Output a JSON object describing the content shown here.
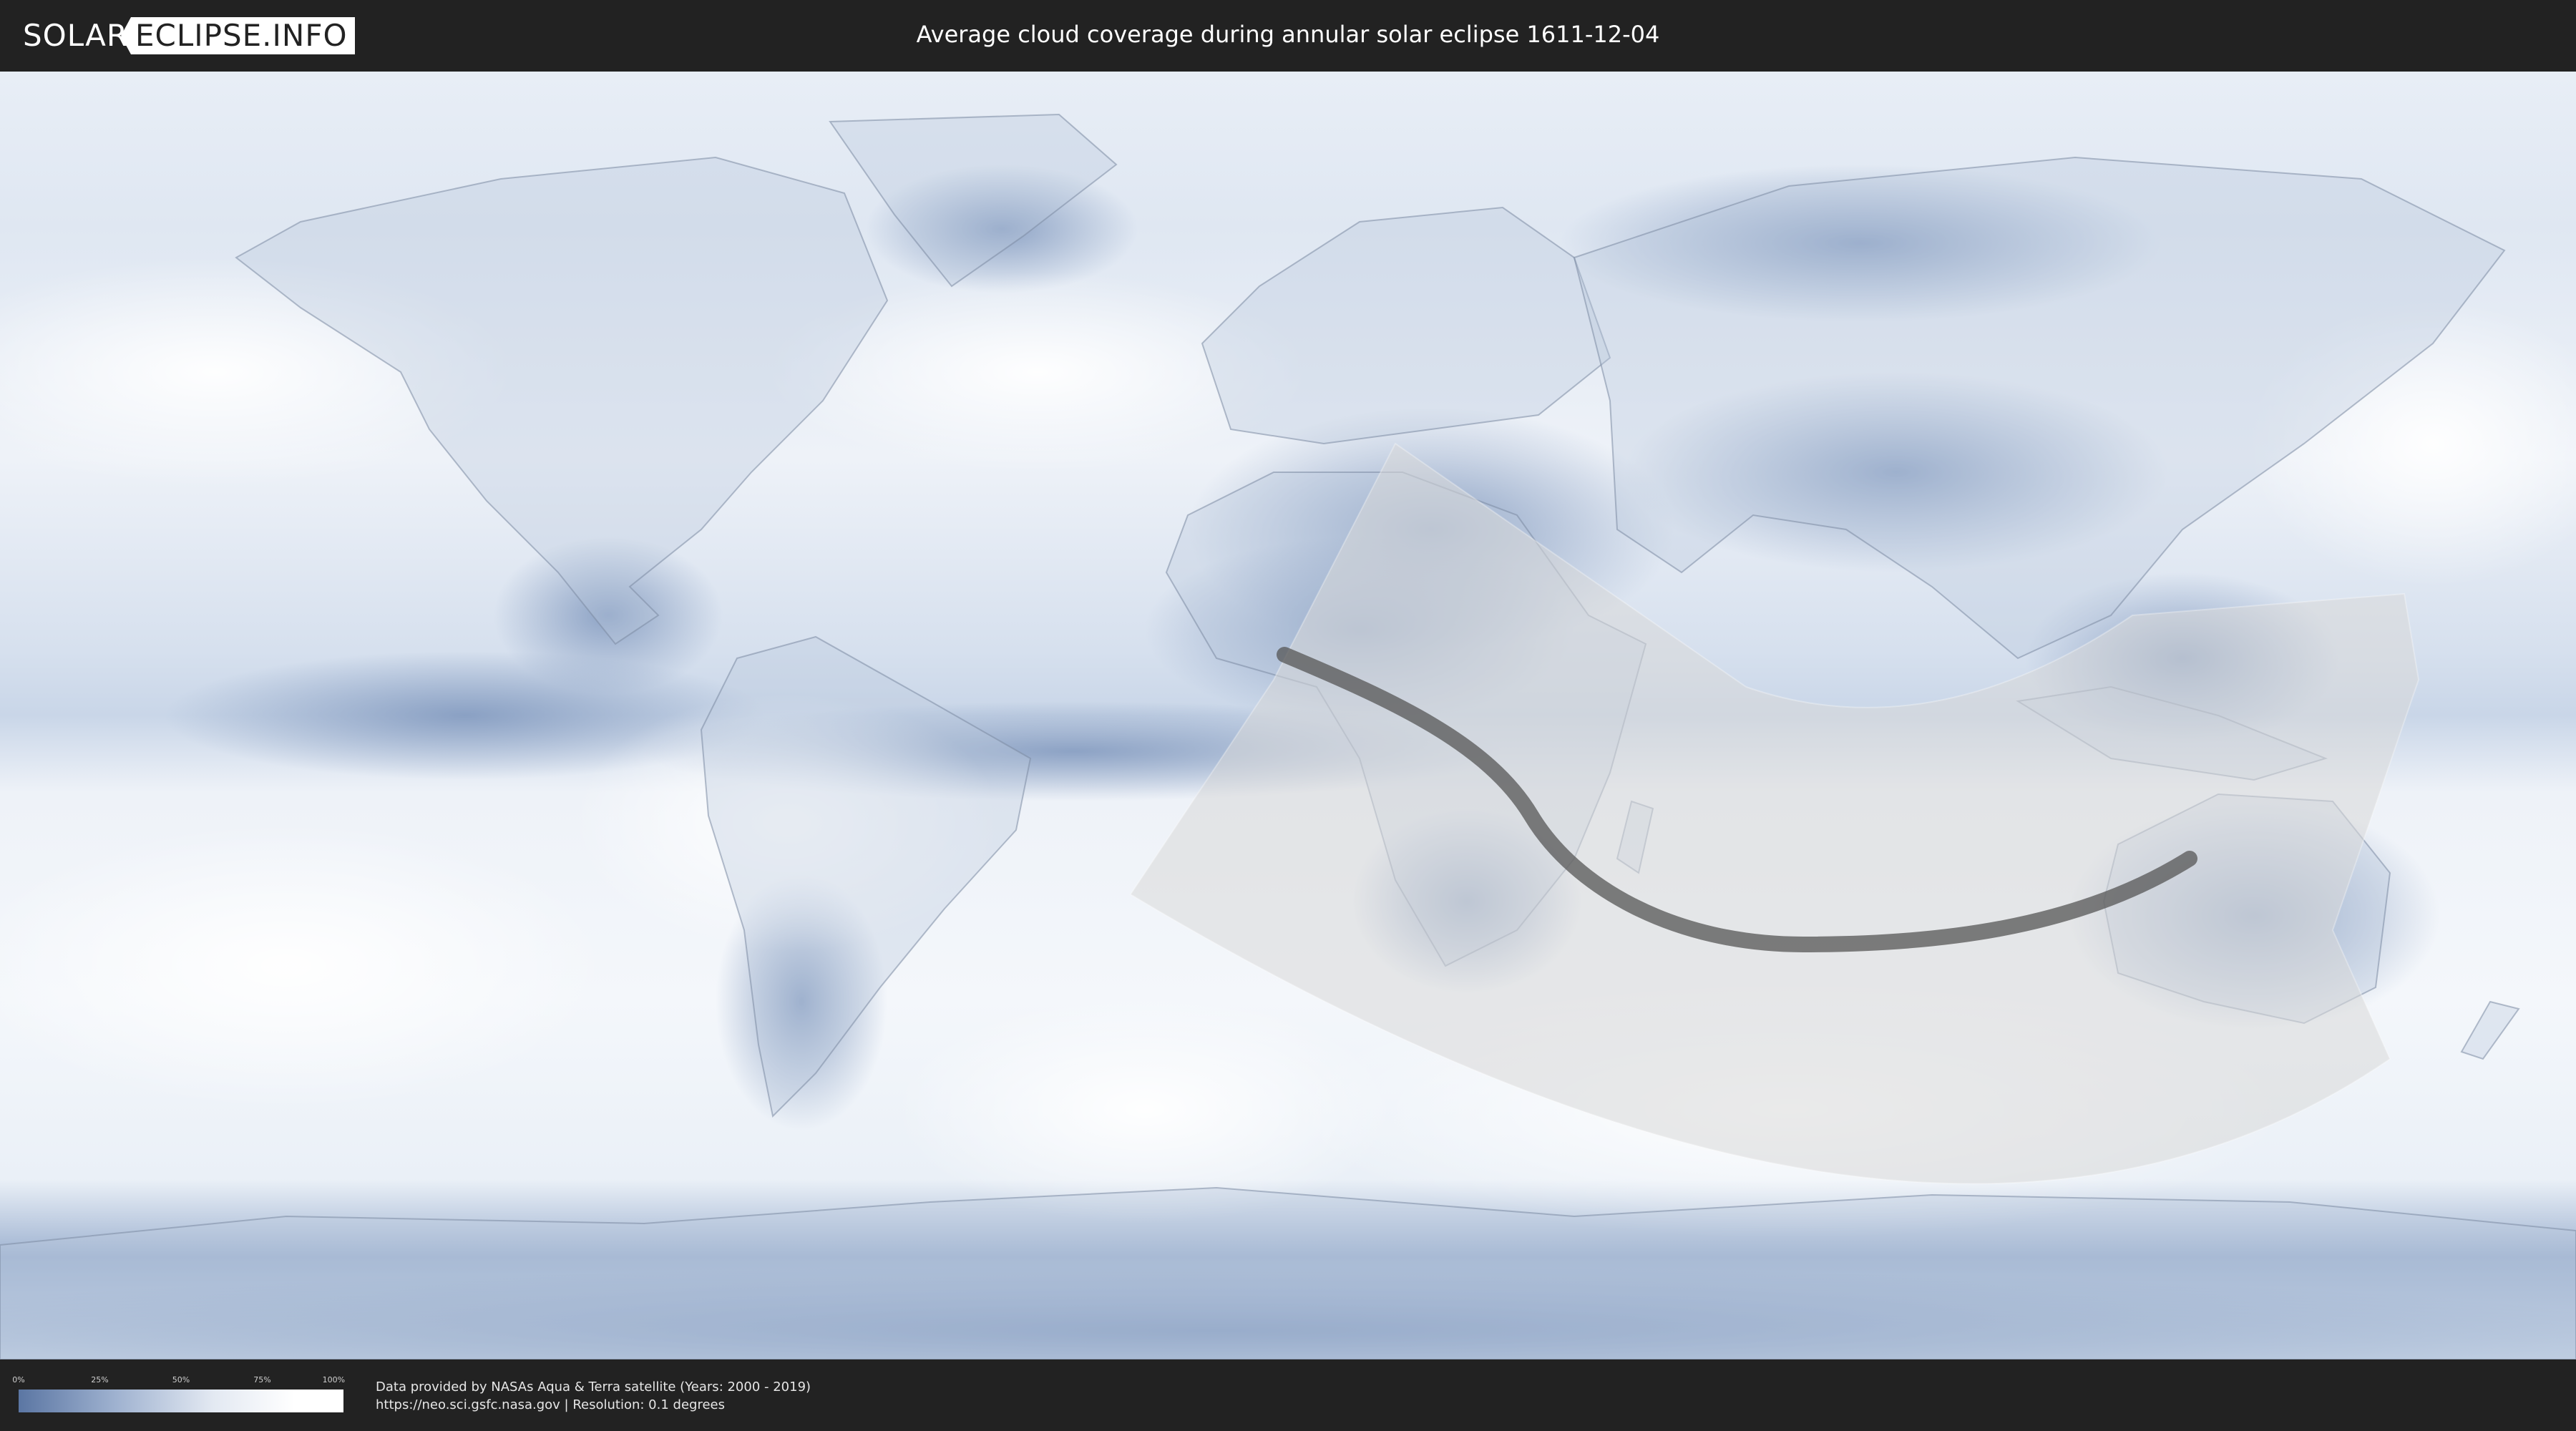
{
  "header": {
    "logo_left": "SOLAR",
    "logo_right": "ECLIPSE.INFO",
    "title": "Average cloud coverage during annular solar eclipse 1611-12-04"
  },
  "legend": {
    "scale_labels": [
      "0%",
      "25%",
      "50%",
      "75%",
      "100%"
    ],
    "scale_colors": [
      "#5b76a3",
      "#9fb2d0",
      "#e3e9f2",
      "#ffffff"
    ]
  },
  "footer": {
    "credit_line1": "Data provided by NASAs Aqua & Terra satellite (Years: 2000 - 2019)",
    "credit_line2": "https://neo.sci.gsfc.nasa.gov | Resolution: 0.1 degrees"
  },
  "map": {
    "projection": "equirectangular",
    "colors": {
      "ocean_cloud": "#e4ebf4",
      "clear_sky": "#8ea4c6",
      "dense_cloud": "#ffffff",
      "eclipse_zone": "#d9d9d9",
      "central_path": "#555555",
      "borders": "#7b8aa3"
    }
  }
}
